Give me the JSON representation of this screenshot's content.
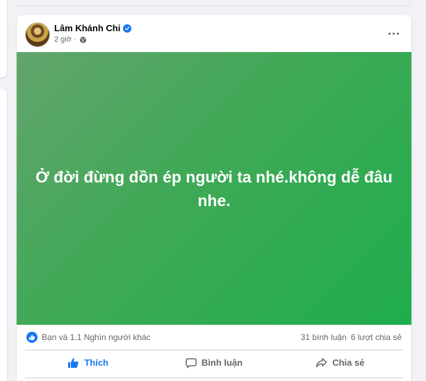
{
  "post": {
    "author": "Lâm Khánh Chi",
    "time": "2 giờ",
    "content": "Ở đời đừng dồn ép người ta nhé.không dễ đâu nhe.",
    "background_gradient": [
      "#63a46d",
      "#1fad4e"
    ],
    "reactions": {
      "summary": "Bạn và 1.1 Nghìn người khác",
      "comments": "31 bình luận",
      "shares": "6 lượt chia sẻ"
    },
    "actions": {
      "like": "Thích",
      "comment": "Bình luận",
      "share": "Chia sẻ"
    }
  },
  "colors": {
    "accent": "#1877f2",
    "secondary_text": "#65676b",
    "page_bg": "#f0f2f5"
  },
  "icons": {
    "verified": "verified-badge-icon",
    "privacy": "globe-icon",
    "menu": "more-horizontal-icon",
    "reaction": "like-reaction-icon",
    "like": "thumbs-up-icon",
    "comment": "comment-bubble-icon",
    "share": "share-arrow-icon"
  }
}
